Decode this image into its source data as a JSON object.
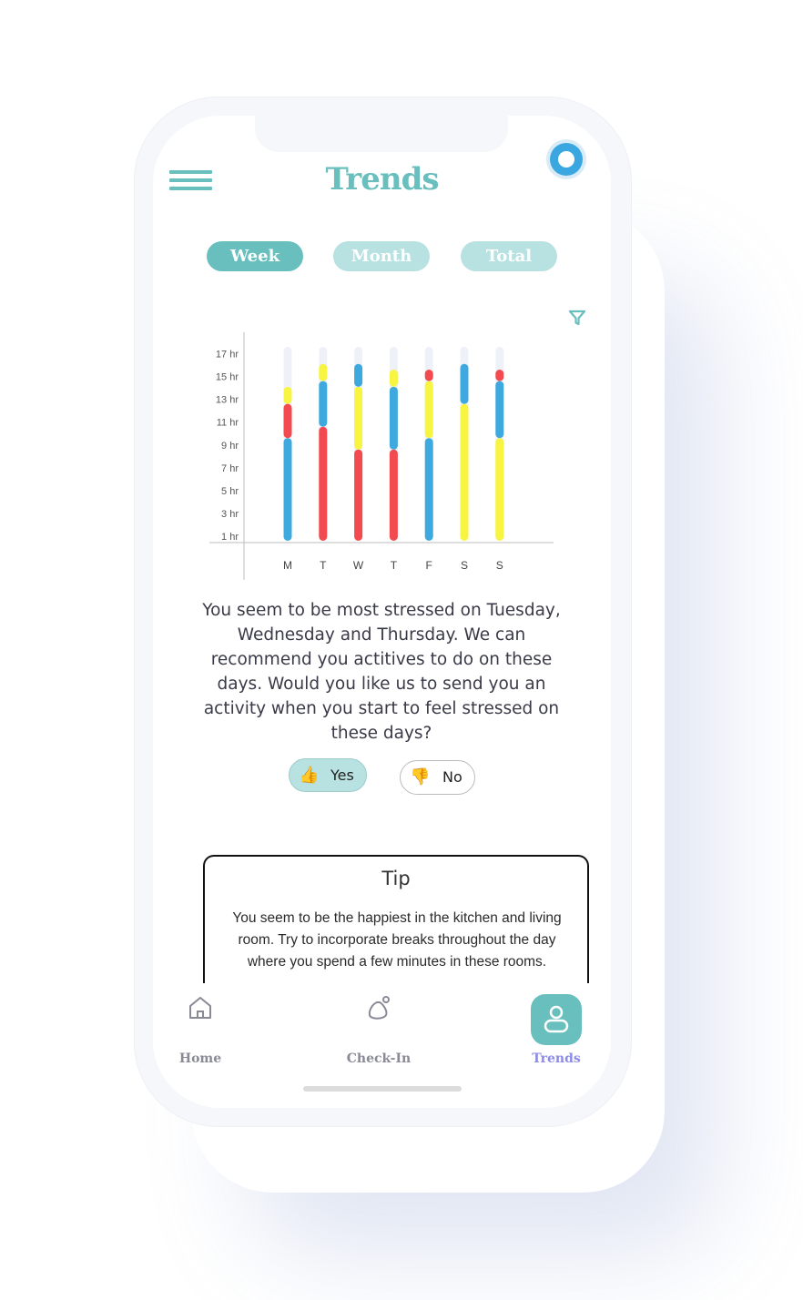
{
  "header": {
    "title": "Trends",
    "menu_icon": "hamburger-menu-icon",
    "record_icon": "record-circle-icon"
  },
  "tabs": [
    {
      "label": "Week",
      "active": true
    },
    {
      "label": "Month",
      "active": false
    },
    {
      "label": "Total",
      "active": false
    }
  ],
  "filter_icon": "filter-icon",
  "chart_data": {
    "type": "bar",
    "stacked": true,
    "categories": [
      "M",
      "T",
      "W",
      "T",
      "F",
      "S",
      "S"
    ],
    "y_ticks": [
      "1 hr",
      "3 hr",
      "5 hr",
      "7 hr",
      "9 hr",
      "11 hr",
      "13 hr",
      "15 hr",
      "17 hr"
    ],
    "ylim": [
      0,
      17
    ],
    "stacks": [
      [
        {
          "color": "#3ea9df",
          "value": 9
        },
        {
          "color": "#f24a4e",
          "value": 3
        },
        {
          "color": "#f7f542",
          "value": 1.5
        }
      ],
      [
        {
          "color": "#f24a4e",
          "value": 10
        },
        {
          "color": "#3ea9df",
          "value": 4
        },
        {
          "color": "#f7f542",
          "value": 1.5
        }
      ],
      [
        {
          "color": "#f24a4e",
          "value": 8
        },
        {
          "color": "#f7f542",
          "value": 5.5
        },
        {
          "color": "#3ea9df",
          "value": 2
        }
      ],
      [
        {
          "color": "#f24a4e",
          "value": 8
        },
        {
          "color": "#3ea9df",
          "value": 5.5
        },
        {
          "color": "#f7f542",
          "value": 1.5
        }
      ],
      [
        {
          "color": "#3ea9df",
          "value": 9
        },
        {
          "color": "#f7f542",
          "value": 5
        },
        {
          "color": "#f24a4e",
          "value": 1
        }
      ],
      [
        {
          "color": "#f7f542",
          "value": 12
        },
        {
          "color": "#3ea9df",
          "value": 3.5
        }
      ],
      [
        {
          "color": "#f7f542",
          "value": 9
        },
        {
          "color": "#3ea9df",
          "value": 5
        },
        {
          "color": "#f24a4e",
          "value": 1
        }
      ]
    ],
    "background_bar_max": 17,
    "grid": false
  },
  "message": "You seem to be most stressed on Tuesday, Wednesday and Thursday. We can recommend you actitives to do on these days. Would you like us to send you an activity when you start to feel stressed on these days?",
  "response_buttons": {
    "yes": {
      "emoji": "👍",
      "label": "Yes"
    },
    "no": {
      "emoji": "👎",
      "label": "No"
    }
  },
  "tip": {
    "title": "Tip",
    "body": "You seem to be the happiest in the kitchen and living room. Try to incorporate breaks throughout the day where you spend a few minutes in these rooms."
  },
  "nav": [
    {
      "label": "Home",
      "icon": "home-icon",
      "active": false
    },
    {
      "label": "Check-In",
      "icon": "check-in-icon",
      "active": false
    },
    {
      "label": "Trends",
      "icon": "person-icon",
      "active": true
    }
  ],
  "colors": {
    "accent": "#68bfbd",
    "accent_light": "#b8e2e1",
    "nav_active": "#8c8be6",
    "blue": "#3ea9df",
    "red": "#f24a4e",
    "yellow": "#f7f542"
  }
}
